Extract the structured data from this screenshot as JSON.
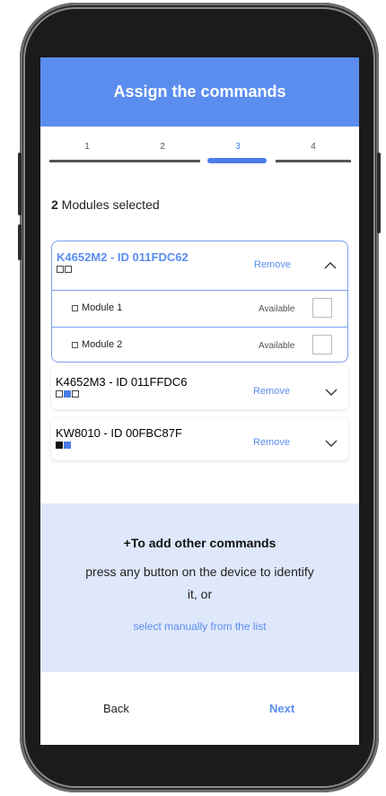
{
  "header": {
    "title": "Assign the commands"
  },
  "stepper": {
    "steps": [
      "1",
      "2",
      "3",
      "4"
    ],
    "active_step": "3"
  },
  "selection": {
    "count": "2",
    "label": " Modules selected"
  },
  "modules": [
    {
      "title": "K4652M2 - ID 011FDC62",
      "remove_label": "Remove",
      "expanded": true,
      "sub_items": [
        {
          "label": "Module 1",
          "status": "Available"
        },
        {
          "label": "Module 2",
          "status": "Available"
        }
      ]
    },
    {
      "title": "K4652M3 - ID 011FFDC6",
      "remove_label": "Remove",
      "expanded": false
    },
    {
      "title": "KW8010 - ID 00FBC87F",
      "remove_label": "Remove",
      "expanded": false
    }
  ],
  "info": {
    "title": "+To add other commands",
    "line1": "press any button on the device to identify",
    "line2": "it, or",
    "link": "select manually from the list"
  },
  "footer": {
    "back_label": "Back",
    "next_label": "Next"
  },
  "colors": {
    "accent": "#5b8def",
    "info_bg": "#dfe8fb"
  }
}
